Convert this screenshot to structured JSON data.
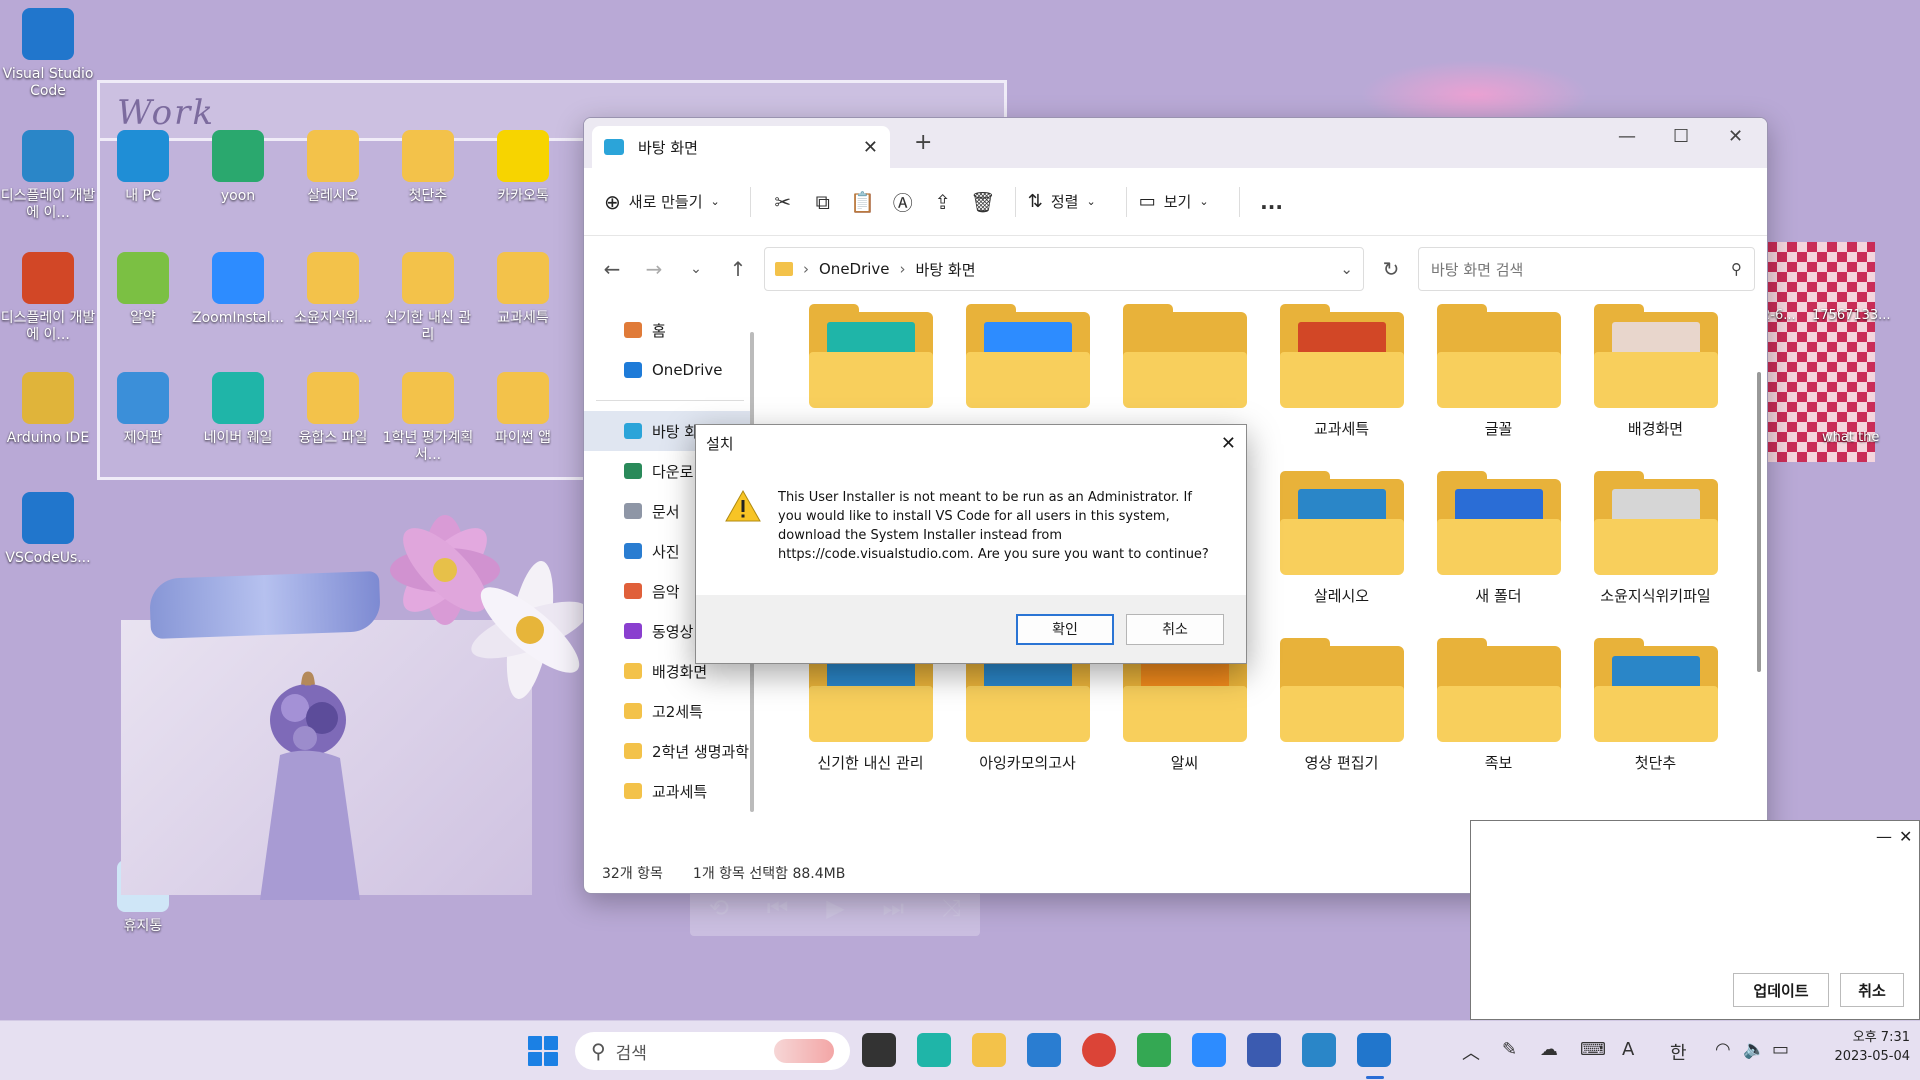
{
  "desktop": {
    "icons_left": [
      {
        "label": "Visual Studio Code",
        "icon": "vscode-icon",
        "color": "#2176cc"
      },
      {
        "label": "디스플레이 개발에 이...",
        "icon": "hwp-icon",
        "color": "#2a86c8"
      },
      {
        "label": "디스플레이 개발에 이...",
        "icon": "powerpoint-icon",
        "color": "#d24726"
      },
      {
        "label": "Arduino IDE",
        "icon": "arduino-icon",
        "color": "#e0b43a"
      },
      {
        "label": "VSCodeUs...",
        "icon": "vscode-icon",
        "color": "#2176cc"
      },
      {
        "label": "휴지통",
        "icon": "recycle-bin-icon",
        "color": "#cfe6f7"
      }
    ],
    "work_label": "Work",
    "work_icons": [
      {
        "label": "내 PC",
        "icon": "monitor-icon",
        "color": "#1f8ed6"
      },
      {
        "label": "yoon",
        "icon": "folder-icon",
        "color": "#2aa86e"
      },
      {
        "label": "살레시오",
        "icon": "folder-icon",
        "color": "#f3c24a"
      },
      {
        "label": "첫단추",
        "icon": "folder-icon",
        "color": "#f3c24a"
      },
      {
        "label": "카카오톡",
        "icon": "kakaotalk-icon",
        "color": "#f7d400"
      },
      {
        "label": "알약",
        "icon": "alyac-icon",
        "color": "#7bc043"
      },
      {
        "label": "ZoomInstal...",
        "icon": "zoom-icon",
        "color": "#2d8cff"
      },
      {
        "label": "소윤지식위...",
        "icon": "folder-icon",
        "color": "#f3c24a"
      },
      {
        "label": "신기한 내신 관리",
        "icon": "folder-icon",
        "color": "#f3c24a"
      },
      {
        "label": "교과세특",
        "icon": "folder-icon",
        "color": "#f3c24a"
      },
      {
        "label": "제어판",
        "icon": "control-panel-icon",
        "color": "#3b8fd9"
      },
      {
        "label": "네이버 웨일",
        "icon": "whale-icon",
        "color": "#1fb5a8"
      },
      {
        "label": "융합스 파일",
        "icon": "folder-icon",
        "color": "#f3c24a"
      },
      {
        "label": "1학년 평가계획서...",
        "icon": "folder-icon",
        "color": "#f3c24a"
      },
      {
        "label": "파이썬 앱",
        "icon": "folder-icon",
        "color": "#f3c24a"
      }
    ],
    "right_labels": [
      "2-6...",
      "17567133...",
      "what the"
    ]
  },
  "explorer": {
    "tab_title": "바탕 화면",
    "toolbar": {
      "new_label": "새로 만들기",
      "sort_label": "정렬",
      "view_label": "보기",
      "more_label": "..."
    },
    "breadcrumb": [
      "OneDrive",
      "바탕 화면"
    ],
    "search_placeholder": "바탕 화면 검색",
    "nav": [
      {
        "label": "홈",
        "icon": "home-icon",
        "color": "#e07b39"
      },
      {
        "label": "OneDrive",
        "icon": "onedrive-icon",
        "color": "#1e7bd8"
      },
      {
        "label": "바탕 화",
        "icon": "desktop-icon",
        "color": "#2ba4d9"
      },
      {
        "label": "다운로",
        "icon": "download-icon",
        "color": "#2a8a5a"
      },
      {
        "label": "문서",
        "icon": "document-icon",
        "color": "#8e96a6"
      },
      {
        "label": "사진",
        "icon": "picture-icon",
        "color": "#2a7dd1"
      },
      {
        "label": "음악",
        "icon": "music-icon",
        "color": "#e0603a"
      },
      {
        "label": "동영상",
        "icon": "video-icon",
        "color": "#8a3fcf"
      },
      {
        "label": "배경화면",
        "icon": "folder-icon",
        "color": "#f3c24a"
      },
      {
        "label": "고2세특",
        "icon": "folder-icon",
        "color": "#f3c24a"
      },
      {
        "label": "2학년 생명과학",
        "icon": "folder-icon",
        "color": "#f3c24a"
      },
      {
        "label": "교과세특",
        "icon": "folder-icon",
        "color": "#f3c24a"
      }
    ],
    "items": [
      {
        "label": "",
        "overlay": "#1fb5a8"
      },
      {
        "label": "",
        "overlay": "#2d8cff"
      },
      {
        "label": "",
        "overlay": ""
      },
      {
        "label": "교과세특",
        "overlay": "#d24726"
      },
      {
        "label": "글꼴",
        "overlay": ""
      },
      {
        "label": "배경화면",
        "overlay": "#e8d6cc"
      },
      {
        "label": "",
        "overlay": ""
      },
      {
        "label": "",
        "overlay": ""
      },
      {
        "label": "",
        "overlay": ""
      },
      {
        "label": "살레시오",
        "overlay": "#2a86c8"
      },
      {
        "label": "새 폴더",
        "overlay": "#2a6dd6"
      },
      {
        "label": "소윤지식위키파일",
        "overlay": "#d6d6d6"
      },
      {
        "label": "신기한 내신 관리",
        "overlay": "#2a86c8"
      },
      {
        "label": "아잉카모의고사",
        "overlay": "#2a86c8"
      },
      {
        "label": "알씨",
        "overlay": "#f08a1c"
      },
      {
        "label": "영상 편집기",
        "overlay": ""
      },
      {
        "label": "족보",
        "overlay": ""
      },
      {
        "label": "첫단추",
        "overlay": "#2a86c8"
      }
    ],
    "status_count": "32개 항목",
    "status_selected": "1개 항목 선택함 88.4MB"
  },
  "dialog": {
    "title": "설치",
    "message": "This User Installer is not meant to be run as an Administrator. If you would like to install VS Code for all users in this system, download the System Installer instead from https://code.visualstudio.com. Are you sure you want to continue?",
    "ok_label": "확인",
    "cancel_label": "취소"
  },
  "update_window": {
    "update_label": "업데이트",
    "cancel_label": "취소"
  },
  "taskbar": {
    "search_label": "검색",
    "apps": [
      "task-view-icon",
      "whale-icon",
      "file-explorer-icon",
      "mail-icon",
      "chrome-icon",
      "green-app-icon",
      "zoom-icon",
      "app-icon",
      "hwp-icon",
      "vscode-icon"
    ],
    "time": "오후 7:31",
    "date": "2023-05-04",
    "ime": "한",
    "font_a": "A"
  },
  "colors": {
    "desktop_bg": "#b9a9d6",
    "accent": "#2a74d4",
    "folder": "#f8cf5c"
  }
}
